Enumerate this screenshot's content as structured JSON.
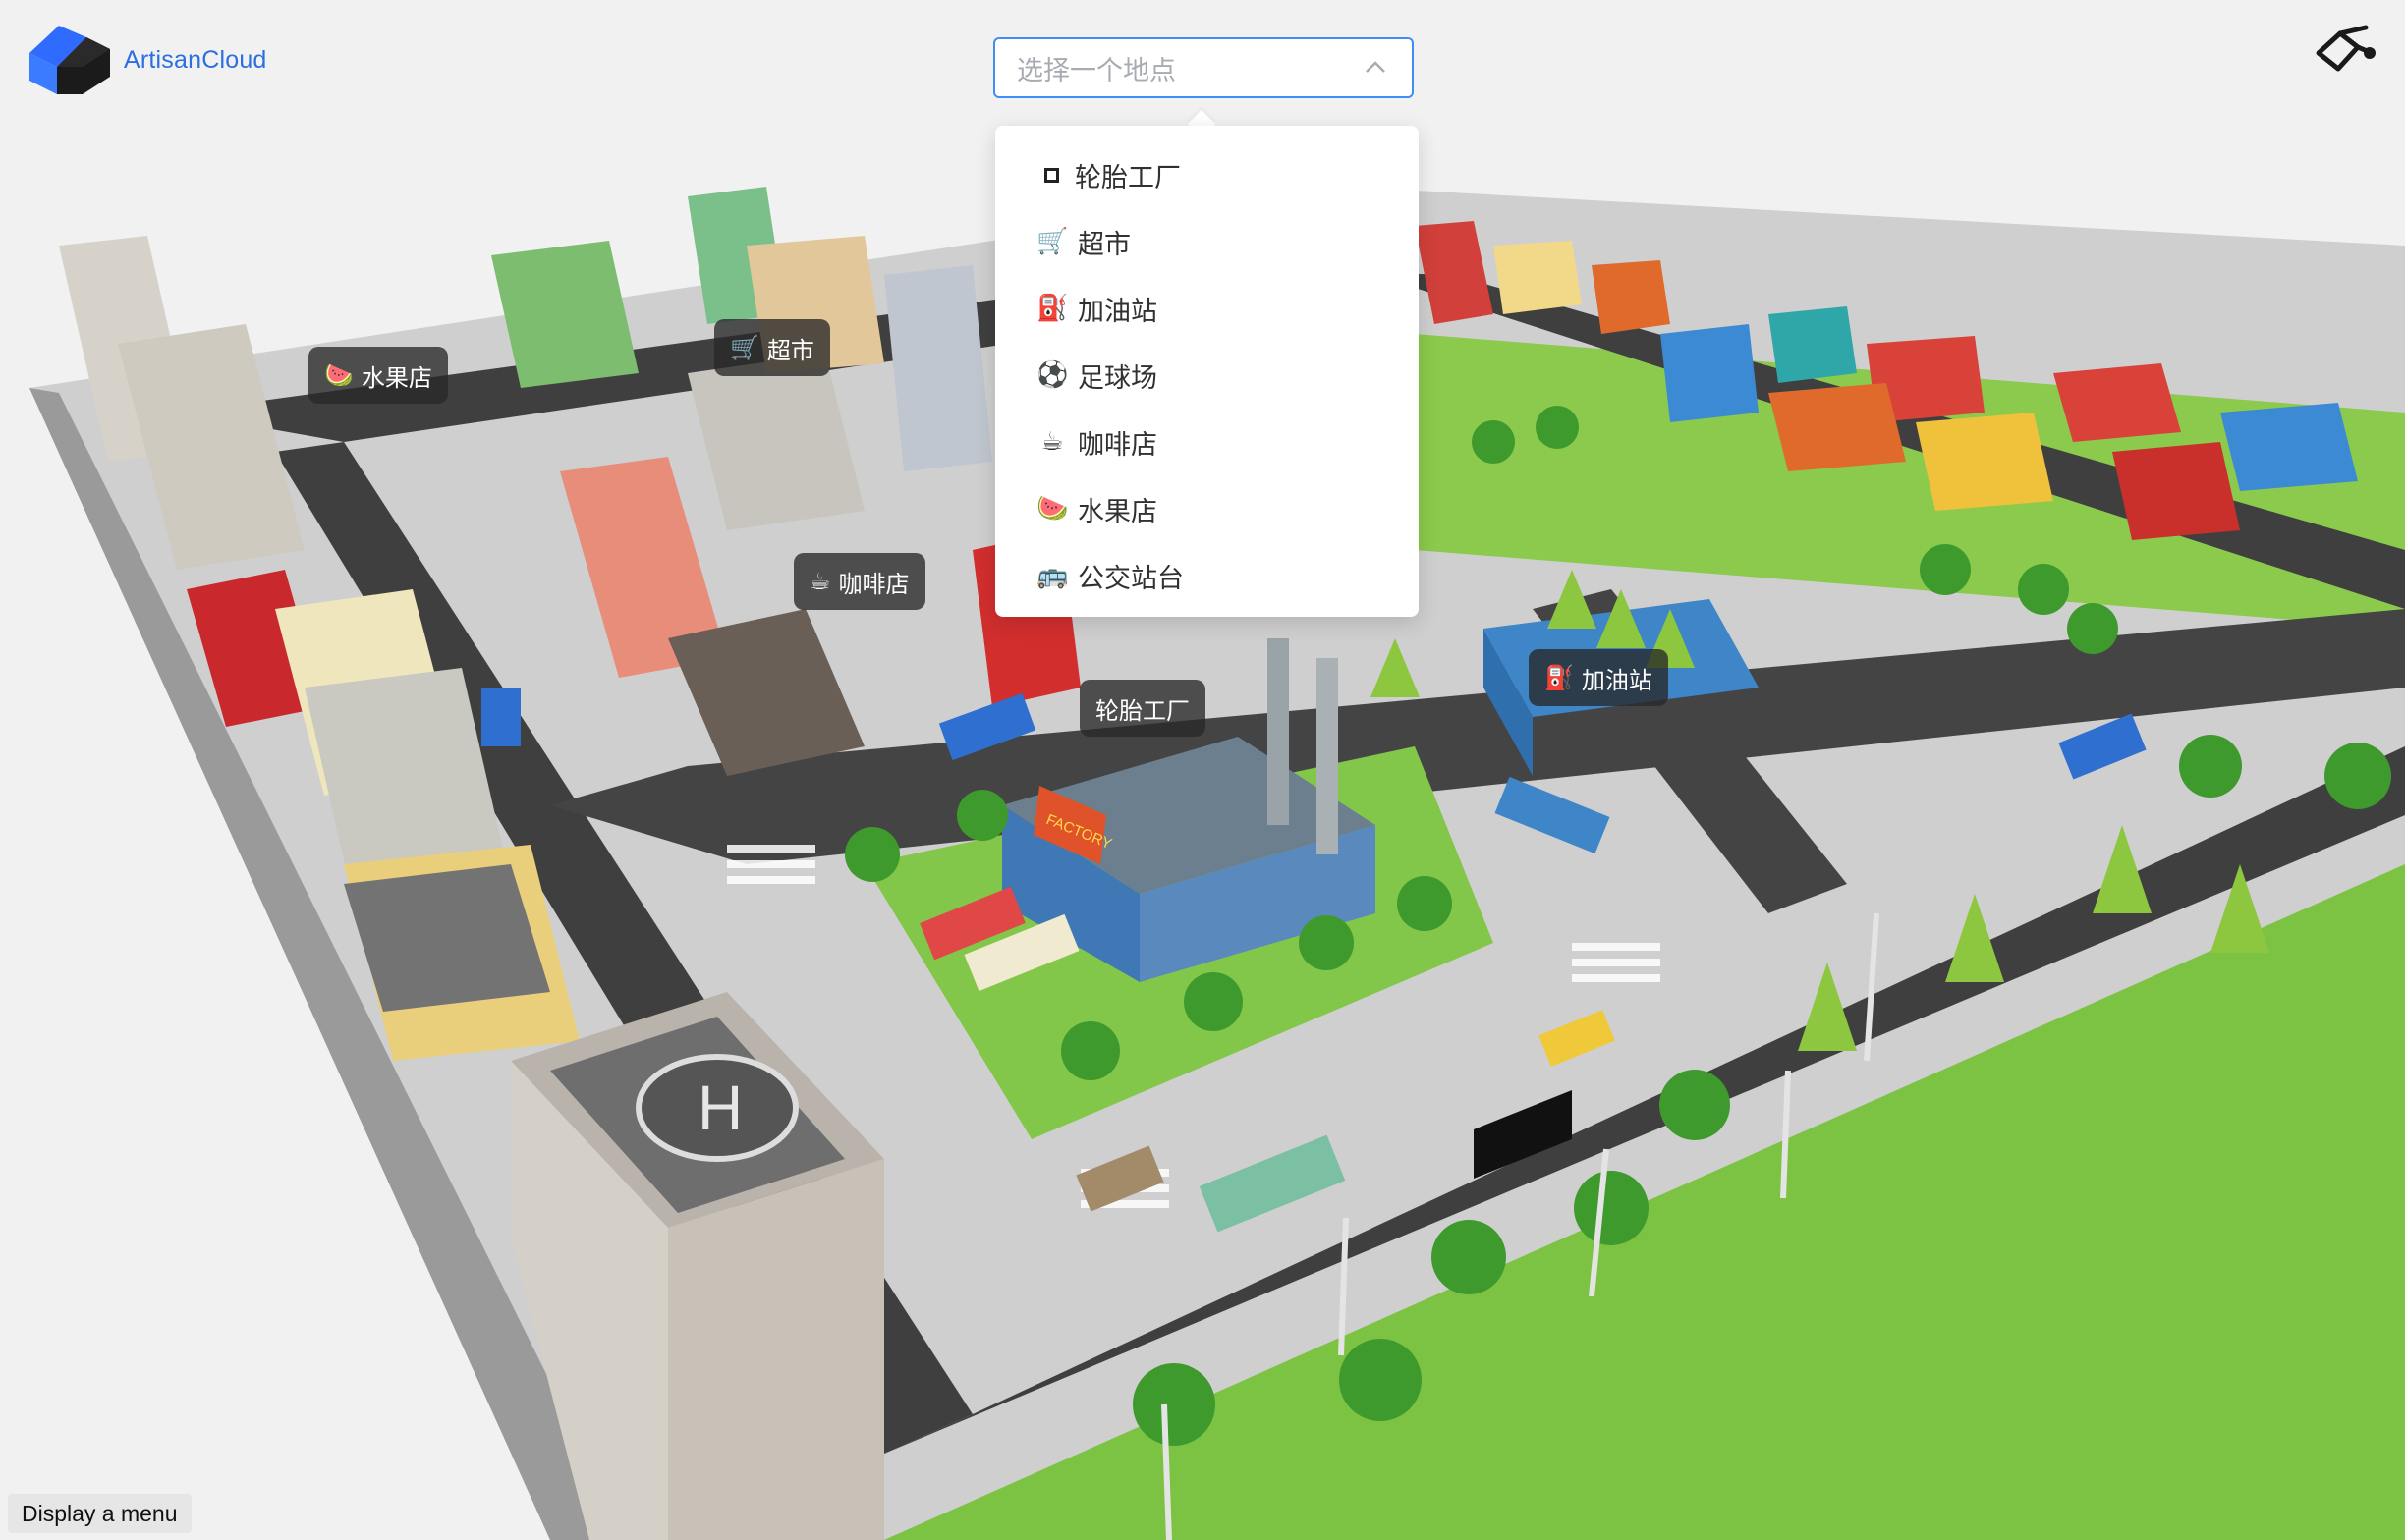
{
  "brand": {
    "name": "ArtisanCloud",
    "logo_icon": "cube-logo-icon"
  },
  "colors": {
    "brand_blue": "#2b6fe0",
    "select_border": "#3d8ef7",
    "grass": "#7cc243",
    "road": "#3f3f3f"
  },
  "location_select": {
    "placeholder": "选择一个地点",
    "expanded": true,
    "options": [
      {
        "icon": "square-icon",
        "label": "轮胎工厂"
      },
      {
        "icon": "cart-icon",
        "label": "超市",
        "glyph": "🛒"
      },
      {
        "icon": "fuel-pump-icon",
        "label": "加油站",
        "glyph": "⛽"
      },
      {
        "icon": "soccer-ball-icon",
        "label": "足球场",
        "glyph": "⚽"
      },
      {
        "icon": "coffee-icon",
        "label": "咖啡店",
        "glyph": "☕"
      },
      {
        "icon": "watermelon-icon",
        "label": "水果店",
        "glyph": "🍉"
      },
      {
        "icon": "bus-icon",
        "label": "公交站台",
        "glyph": "🚌"
      }
    ]
  },
  "map_labels": [
    {
      "name": "fruit-shop",
      "text": "水果店",
      "glyph": "🍉"
    },
    {
      "name": "supermarket",
      "text": "超市",
      "glyph": "🛒"
    },
    {
      "name": "coffee-shop",
      "text": "咖啡店",
      "glyph": "☕"
    },
    {
      "name": "tire-factory",
      "text": "轮胎工厂",
      "glyph": ""
    },
    {
      "name": "gas-station",
      "text": "加油站",
      "glyph": "⛽"
    }
  ],
  "scene_text": {
    "factory_sign": "FACTORY"
  },
  "top_right_icon": "route-link-icon",
  "menu_button": {
    "label": "Display a menu"
  }
}
